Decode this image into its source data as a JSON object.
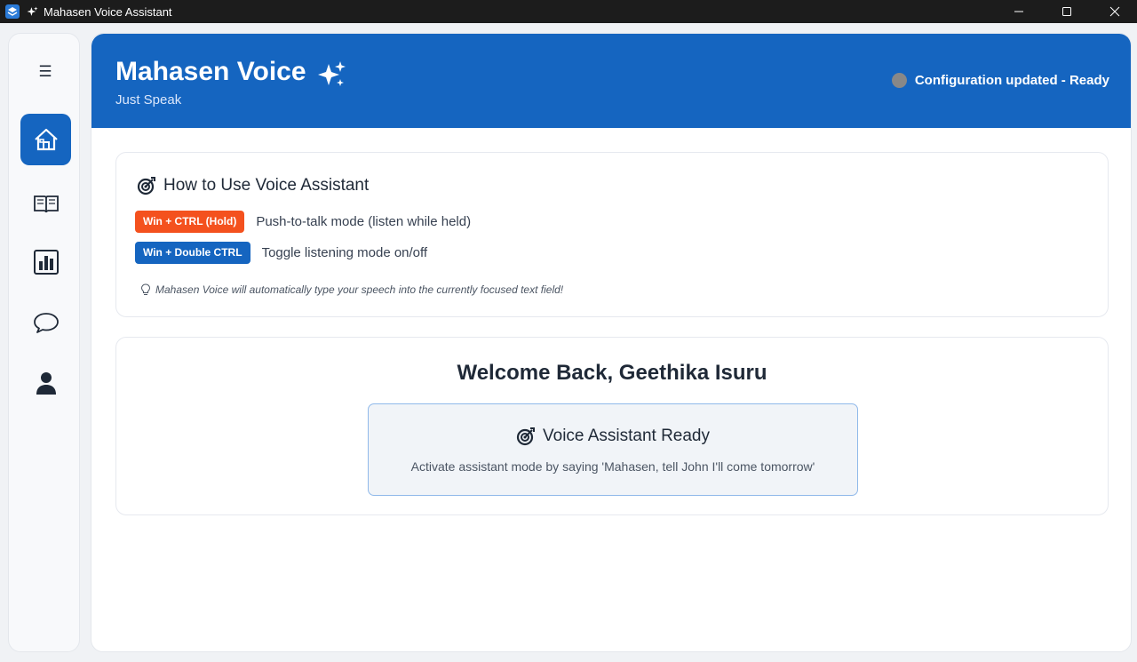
{
  "window": {
    "title": "Mahasen Voice Assistant",
    "controls": [
      "minimize",
      "maximize",
      "close"
    ]
  },
  "sidebar": {
    "menu_icon": "hamburger-icon",
    "items": [
      {
        "id": "home",
        "icon": "home-icon",
        "active": true
      },
      {
        "id": "book",
        "icon": "book-icon",
        "active": false
      },
      {
        "id": "stats",
        "icon": "bar-chart-icon",
        "active": false
      },
      {
        "id": "chat",
        "icon": "chat-bubble-icon",
        "active": false
      },
      {
        "id": "profile",
        "icon": "user-icon",
        "active": false
      }
    ]
  },
  "header": {
    "title": "Mahasen Voice",
    "subtitle": "Just Speak",
    "status_text": "Configuration updated - Ready",
    "status_color": "#888888"
  },
  "howto": {
    "title": "How to Use Voice Assistant",
    "shortcuts": [
      {
        "keys": "Win + CTRL (Hold)",
        "description": "Push-to-talk mode (listen while held)",
        "color": "#f4511e"
      },
      {
        "keys": "Win + Double CTRL",
        "description": "Toggle listening mode on/off",
        "color": "#1565c0"
      }
    ],
    "tip": "Mahasen Voice will automatically type your speech into the currently focused text field!"
  },
  "welcome": {
    "title": "Welcome Back,  Geethika Isuru",
    "ready_title": "Voice Assistant Ready",
    "ready_description": "Activate assistant mode by saying 'Mahasen, tell John I'll come tomorrow'"
  },
  "colors": {
    "primary": "#1565c0",
    "accent_orange": "#f4511e",
    "background": "#f0f2f5"
  }
}
